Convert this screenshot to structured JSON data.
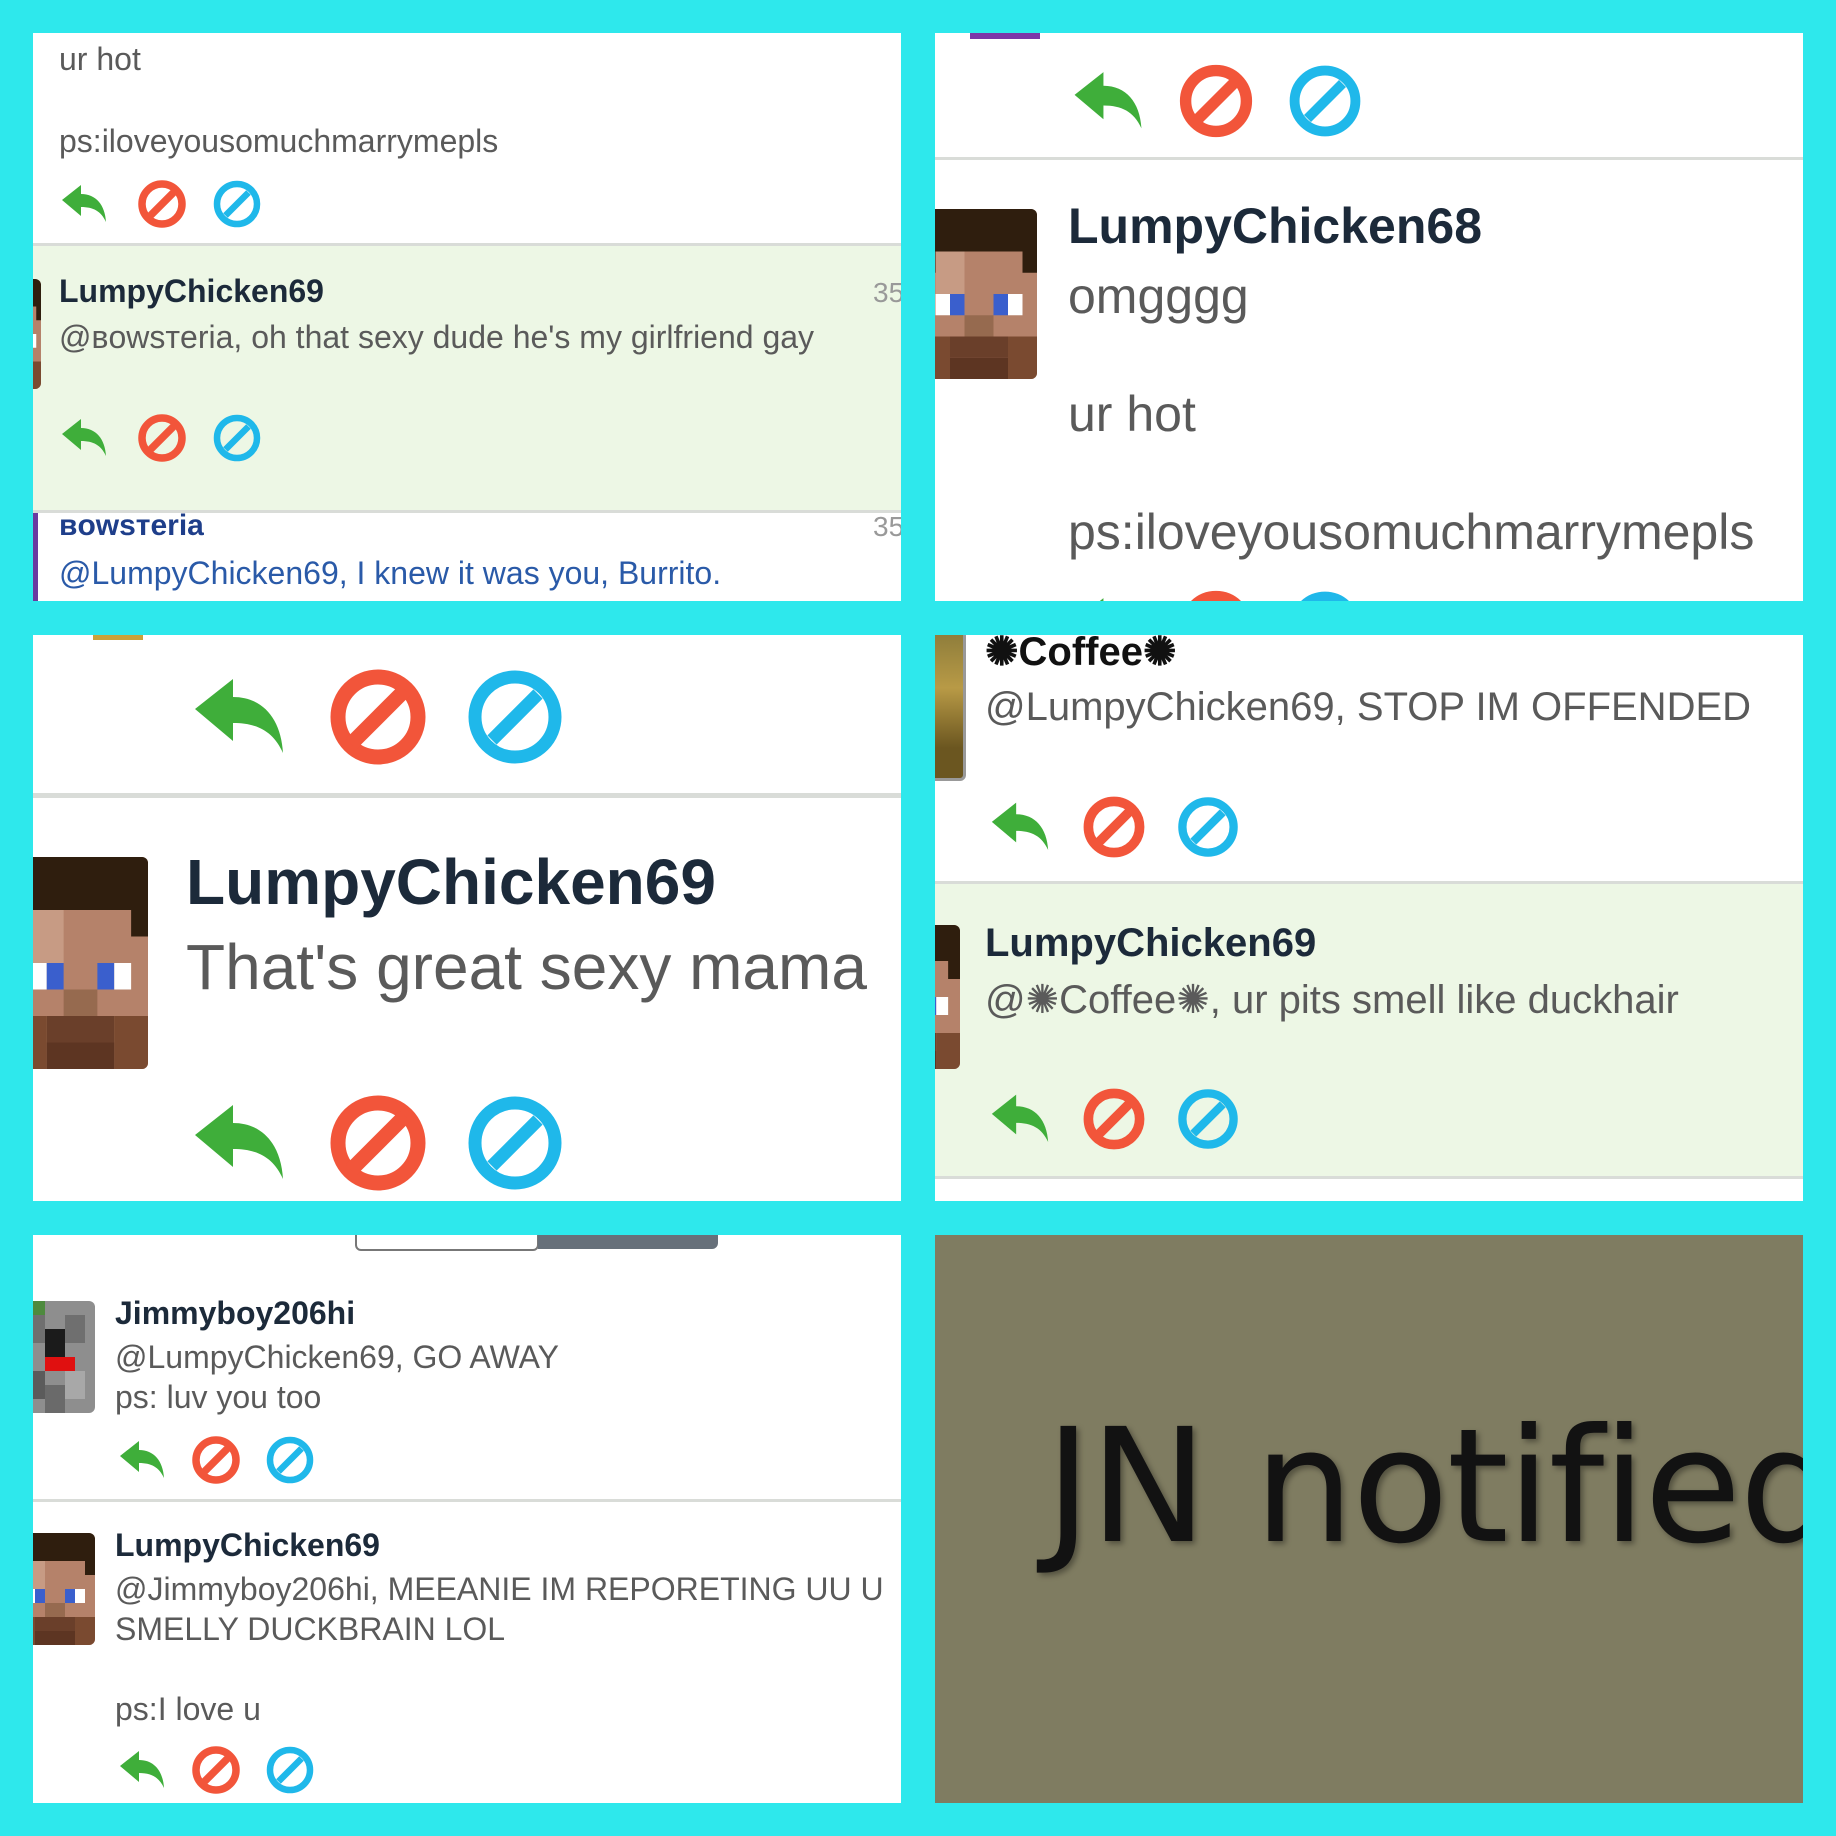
{
  "panel1": {
    "top_text_1": "ur hot",
    "top_text_2": "ps:iloveyousomuchmarrymepls",
    "post1": {
      "user": "LumpyChicken69",
      "text": "@ʙowsтeria, oh that sexy dude he's my girlfriend gay",
      "time": "35"
    },
    "post2": {
      "user": "ʙowsтeria",
      "text": "@LumpyChicken69, I knew it was you, Burrito.",
      "time": "35"
    }
  },
  "panel2": {
    "post": {
      "user": "LumpyChicken68",
      "line1": "omgggg",
      "line2": "ur hot",
      "line3": "ps:iloveyousomuchmarrymepls"
    }
  },
  "panel3": {
    "post": {
      "user": "LumpyChicken69",
      "text": "That's great sexy mama"
    }
  },
  "panel4": {
    "post1": {
      "user": "✺Coffee✺",
      "text": "@LumpyChicken69, STOP IM OFFENDED"
    },
    "post2": {
      "user": "LumpyChicken69",
      "text": "@✺Coffee✺, ur pits smell like duckhair"
    }
  },
  "panel5": {
    "post1": {
      "user": "Jimmyboy206hi",
      "line1": "@LumpyChicken69, GO AWAY",
      "line2": "ps: luv you too"
    },
    "post2": {
      "user": "LumpyChicken69",
      "line1": "@Jimmyboy206hi, MEEANIE IM REPORETING UU U",
      "line2": "SMELLY DUCKBRAIN LOL",
      "line3": "ps:I love u"
    }
  },
  "panel6": {
    "caption": "JN notified"
  },
  "icons": {
    "reply": "reply-arrow-icon",
    "block": "block-icon",
    "mute": "mute-icon"
  },
  "colors": {
    "background": "#2ee8ec",
    "reply": "#3fae3a",
    "block": "#f2553a",
    "mute": "#1fb8ea",
    "highlight": "#edf7e5",
    "caption_bg": "#7f7c61"
  }
}
